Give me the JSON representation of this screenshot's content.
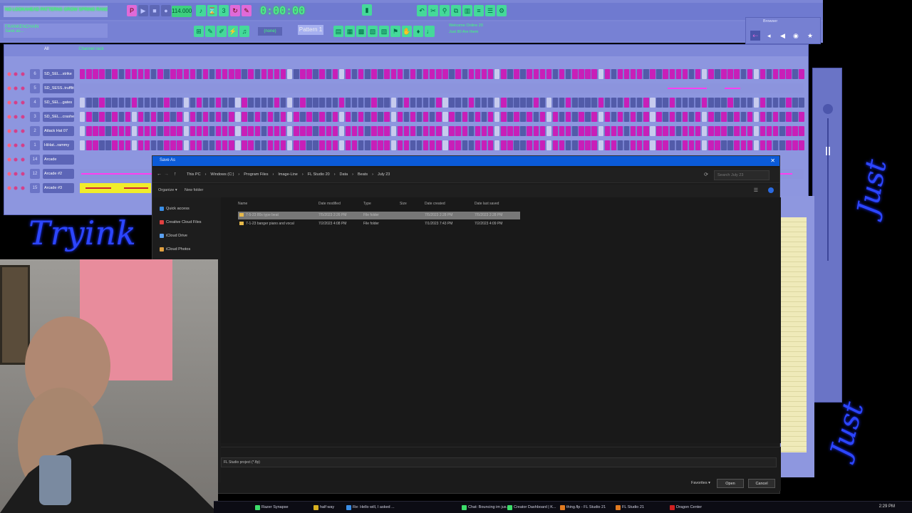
{
  "fl": {
    "hint_line1": "NO LOOKAHEAD PATTERNS GROW SPRING RANGE HIGH",
    "hint_line2a": "FRANKENCHAIN",
    "hint_line2b": "Save as...",
    "tempo": "114.000",
    "time": "0:00:00",
    "pattern": "Pattern 1",
    "snap": "(none)",
    "news": "Welcome Online 20",
    "news2": "Just 80 Are them",
    "browser_title": "Browser"
  },
  "rack": {
    "title": "Channel rack",
    "filter": "All",
    "channels": [
      {
        "num": "6",
        "name": "SD_SEL...strike",
        "pattern": "1111010111101011110101111010111100110101010101011101011110101111010101111010111101011110101111010101110101011101"
      },
      {
        "num": "5",
        "name": "SD_SESS..trufflit",
        "pattern": "roll"
      },
      {
        "num": "4",
        "name": "SD_SEL...gates",
        "pattern": "0001000010000100001001000100001000100000100001000010000100001000010000100001000010001001000100001000100001000100"
      },
      {
        "num": "3",
        "name": "SD_SEL...crasher",
        "pattern": "0101010101010101010101010101010101010101010101010101010101010101010101010101010101010101010101010101010101010101"
      },
      {
        "num": "2",
        "name": "Attack Hat 07",
        "pattern": "0111011101110111011101110111011101110111011101110111011101110111011101110111011101110111011101110111011101110111"
      },
      {
        "num": "1",
        "name": "HiHat...rammy",
        "pattern": "0110011101100111011001110110011101100111011001110110011101100111011001110110011101100111011001110110011101100111"
      },
      {
        "num": "14",
        "name": "Arcade",
        "pattern": "none"
      },
      {
        "num": "12",
        "name": "Arcade #2",
        "pattern": "roll2"
      },
      {
        "num": "15",
        "name": "Arcade #3",
        "pattern": "yellow"
      }
    ]
  },
  "dialog": {
    "title": "Save As",
    "path": [
      "This PC",
      "Windows (C:)",
      "Program Files",
      "Image-Line",
      "FL Studio 20",
      "Data",
      "Beats",
      "July 23"
    ],
    "search_placeholder": "Search July 23",
    "organize": "Organize ▾",
    "new_folder": "New folder",
    "nav": [
      {
        "label": "Quick access",
        "color": "#3a8ee6"
      },
      {
        "label": "Creative Cloud Files",
        "color": "#e04040"
      },
      {
        "label": "iCloud Drive",
        "color": "#5aa0f0"
      },
      {
        "label": "iCloud Photos",
        "color": "#e0a040"
      }
    ],
    "columns": [
      "Name",
      "Date modified",
      "Type",
      "Size",
      "Date created",
      "Date last saved"
    ],
    "files": [
      {
        "name": "7-5-23 80s type beat",
        "modified": "7/5/2023 2:26 PM",
        "type": "File folder",
        "size": "",
        "created": "7/5/2023 2:28 PM",
        "saved": "7/5/2023 2:28 PM"
      },
      {
        "name": "7-1-23 banger piano and vocal",
        "modified": "7/2/2023 4:08 PM",
        "type": "File folder",
        "size": "",
        "created": "7/1/2023 7:43 PM",
        "saved": "7/2/2023 4:09 PM"
      }
    ],
    "filetype": "FL Studio project (*.flp)",
    "favorites": "Favorites ▾",
    "open": "Open",
    "cancel": "Cancel"
  },
  "taskbar": {
    "items": [
      {
        "label": "Razer Synapse",
        "color": "#3ddc6a"
      },
      {
        "label": "half way",
        "color": "#d8b020"
      },
      {
        "label": "Re: Hello will, I asked ...",
        "color": "#3a8ee6"
      },
      {
        "label": "Chat: Bouncing im jus...",
        "color": "#3ddc6a"
      },
      {
        "label": "Creator Dashboard | K...",
        "color": "#3ddc6a"
      },
      {
        "label": "thing.flp - FL Studio 21",
        "color": "#e07a20"
      },
      {
        "label": "FL Studio 21",
        "color": "#e07a20"
      },
      {
        "label": "Dragon Center",
        "color": "#d02020"
      }
    ],
    "time": "2:29 PM"
  }
}
